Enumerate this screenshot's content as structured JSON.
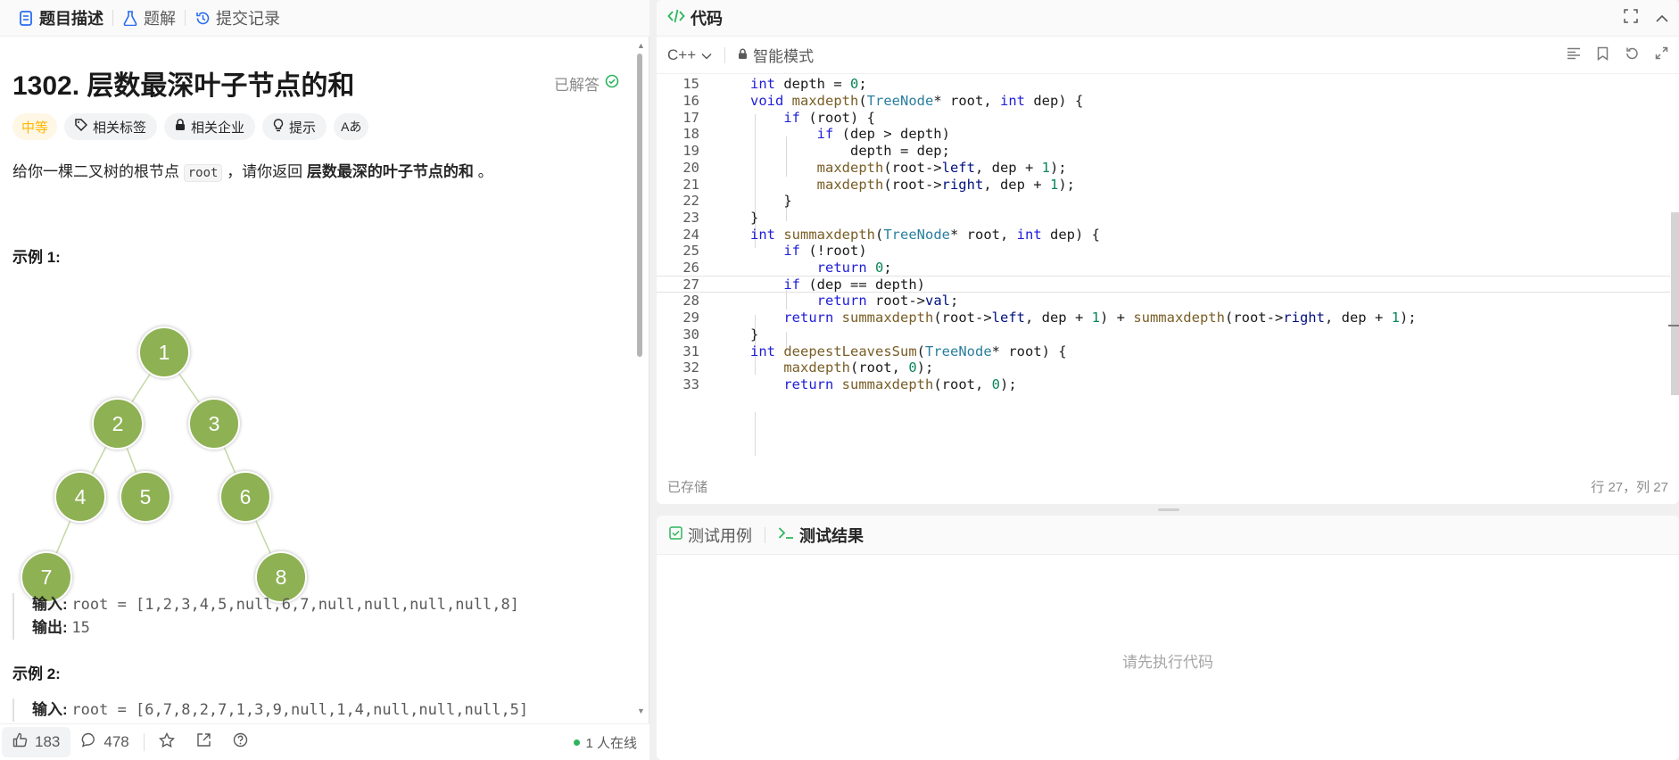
{
  "left_tabs": [
    {
      "label": "题目描述"
    },
    {
      "label": "题解"
    },
    {
      "label": "提交记录"
    }
  ],
  "problem": {
    "title": "1302. 层数最深叶子节点的和",
    "solved_label": "已解答",
    "tags": [
      "中等",
      "相关标签",
      "相关企业",
      "提示",
      "Aあ"
    ],
    "desc_pre": "给你一棵二叉树的根节点 ",
    "desc_code": "root",
    "desc_mid": " ，请你返回 ",
    "desc_bold": "层数最深的叶子节点的和",
    "desc_post": " 。"
  },
  "example1": {
    "title": "示例 1:",
    "tree_nodes": [
      "1",
      "2",
      "3",
      "4",
      "5",
      "6",
      "7",
      "8"
    ],
    "input_label": "输入:",
    "input_value": "root = [1,2,3,4,5,null,6,7,null,null,null,null,8]",
    "output_label": "输出:",
    "output_value": "15"
  },
  "example2": {
    "title": "示例 2:",
    "input_label": "输入:",
    "input_value": "root = [6,7,8,2,7,1,3,9,null,1,4,null,null,null,5]"
  },
  "footer": {
    "likes": "183",
    "comments": "478",
    "online": "1 人在线"
  },
  "editor": {
    "title": "代码",
    "language": "C++",
    "mode": "智能模式",
    "saved": "已存储",
    "cursor": "行 27，列 27",
    "current_line": 27,
    "lines": [
      {
        "no": "15",
        "code": "    int depth = 0;"
      },
      {
        "no": "16",
        "code": "    void maxdepth(TreeNode* root, int dep) {"
      },
      {
        "no": "17",
        "code": "        if (root) {"
      },
      {
        "no": "18",
        "code": "            if (dep > depth)"
      },
      {
        "no": "19",
        "code": "                depth = dep;"
      },
      {
        "no": "20",
        "code": "            maxdepth(root->left, dep + 1);"
      },
      {
        "no": "21",
        "code": "            maxdepth(root->right, dep + 1);"
      },
      {
        "no": "22",
        "code": "        }"
      },
      {
        "no": "23",
        "code": "    }"
      },
      {
        "no": "24",
        "code": "    int summaxdepth(TreeNode* root, int dep) {"
      },
      {
        "no": "25",
        "code": "        if (!root)"
      },
      {
        "no": "26",
        "code": "            return 0;"
      },
      {
        "no": "27",
        "code": "        if (dep == depth)"
      },
      {
        "no": "28",
        "code": "            return root->val;"
      },
      {
        "no": "29",
        "code": "        return summaxdepth(root->left, dep + 1) + summaxdepth(root->right, dep + 1);"
      },
      {
        "no": "30",
        "code": "    }"
      },
      {
        "no": "31",
        "code": "    int deepestLeavesSum(TreeNode* root) {"
      },
      {
        "no": "32",
        "code": "        maxdepth(root, 0);"
      },
      {
        "no": "33",
        "code": "        return summaxdepth(root, 0);"
      }
    ]
  },
  "tests": {
    "tab_cases": "测试用例",
    "tab_results": "测试结果",
    "empty_text": "请先执行代码"
  },
  "colors": {
    "node_fill": "#8eb154",
    "difficulty": "#ffb800",
    "solved_check": "#2db55d",
    "keyword": "#1f1ed8",
    "type": "#2a7f9e"
  }
}
